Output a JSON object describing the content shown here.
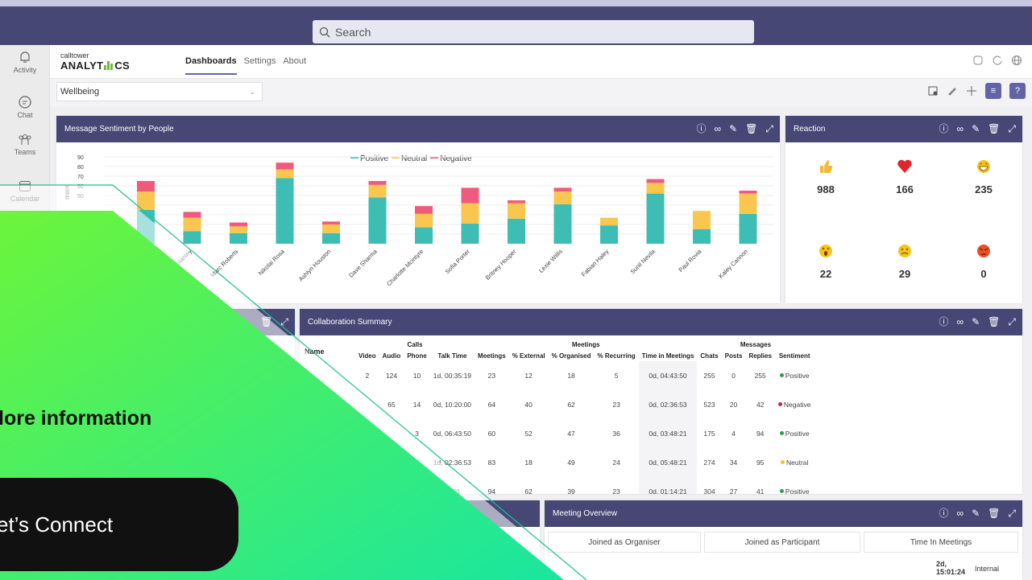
{
  "search": {
    "label": "Search"
  },
  "rail": [
    {
      "label": "Activity",
      "icon": "bell-icon"
    },
    {
      "label": "Chat",
      "icon": "chat-icon"
    },
    {
      "label": "Teams",
      "icon": "teams-icon"
    },
    {
      "label": "Calendar",
      "icon": "calendar-icon"
    }
  ],
  "app": {
    "logo_small": "calltower",
    "logo_big_a": "ANALYT",
    "logo_big_b": "CS",
    "tabs": [
      "Dashboards",
      "Settings",
      "About"
    ],
    "dropdown": "Wellbeing"
  },
  "sentiment": {
    "title": "Message Sentiment by People",
    "legend": [
      "Positive",
      "Neutral",
      "Negative"
    ],
    "ylabel_partial": "ment",
    "yticks": [
      "90",
      "80",
      "70",
      "60",
      "50"
    ]
  },
  "chart_data": {
    "type": "bar",
    "stacked": true,
    "categories": [
      "Jarrett Stanley",
      "Marc Roberts",
      "Nikolai Rosa",
      "Ashlyn Houston",
      "Dave Sharma",
      "Charlotte Mcintyre",
      "Sofia Porter",
      "Britney Hooper",
      "Lexie Willis",
      "Fabian Haley",
      "Sunil Nevila",
      "Paul Rovia",
      "Kaley Cannon"
    ],
    "hidden_first_categories": 2,
    "series": [
      {
        "name": "Positive",
        "color": "#3dbdb4",
        "values": [
          35,
          13,
          11,
          68,
          11,
          48,
          17,
          21,
          26,
          41,
          19,
          52,
          15,
          31
        ]
      },
      {
        "name": "Neutral",
        "color": "#f9c74f",
        "values": [
          19,
          14,
          7,
          9,
          9,
          13,
          14,
          21,
          16,
          13,
          8,
          11,
          19,
          21
        ]
      },
      {
        "name": "Negative",
        "color": "#f05a7e",
        "values": [
          11,
          6,
          4,
          7,
          3,
          4,
          8,
          16,
          3,
          4,
          0,
          4,
          0,
          3
        ]
      }
    ],
    "ylim": [
      0,
      90
    ]
  },
  "reaction": {
    "title": "Reaction",
    "items": [
      {
        "icon": "thumbs-up-icon",
        "value": "988",
        "color": "#f5b93a"
      },
      {
        "icon": "heart-icon",
        "value": "166",
        "color": "#e0262a"
      },
      {
        "icon": "laugh-icon",
        "value": "235",
        "color": "#f5c518"
      },
      {
        "icon": "surprised-icon",
        "value": "22",
        "color": "#f5c518"
      },
      {
        "icon": "sad-icon",
        "value": "29",
        "color": "#f5c518"
      },
      {
        "icon": "angry-icon",
        "value": "0",
        "color": "#e85024"
      }
    ]
  },
  "collab": {
    "title": "Collaboration Summary",
    "name_header": "Name",
    "groups": [
      "Calls",
      "Meetings",
      "Messages"
    ],
    "headers": [
      "Video",
      "Audio",
      "Phone",
      "Talk Time",
      "Meetings",
      "% External",
      "% Organised",
      "% Recurring",
      "Time in Meetings",
      "Chats",
      "Posts",
      "Replies",
      "Sentiment"
    ],
    "rows": [
      [
        "2",
        "124",
        "10",
        "1d, 00:35:19",
        "23",
        "12",
        "18",
        "5",
        "0d, 04:43:50",
        "255",
        "0",
        "255",
        "Positive"
      ],
      [
        "",
        "65",
        "14",
        "0d, 10:20:00",
        "64",
        "40",
        "62",
        "23",
        "0d, 02:36:53",
        "523",
        "20",
        "42",
        "Negative"
      ],
      [
        "",
        "",
        "3",
        "0d, 06:43:50",
        "60",
        "52",
        "47",
        "36",
        "0d, 03:48:21",
        "175",
        "4",
        "94",
        "Positive"
      ],
      [
        "",
        "",
        "",
        "1d, 02:36:53",
        "83",
        "18",
        "49",
        "24",
        "0d, 05:48:21",
        "274",
        "34",
        "95",
        "Neutral"
      ],
      [
        "",
        "",
        "",
        "48:21",
        "94",
        "62",
        "39",
        "23",
        "0d, 01:14:21",
        "304",
        "27",
        "41",
        "Positive"
      ]
    ],
    "sentiment_colors": {
      "Positive": "#2a9d4a",
      "Negative": "#d6213b",
      "Neutral": "#f5c518"
    }
  },
  "meeting": {
    "title": "Meeting Overview",
    "cols": [
      "Joined as Organiser",
      "Joined as Participant",
      "Time In Meetings"
    ],
    "partial_value": "2d, 15:01:24",
    "partial_label": "Internal"
  },
  "promo": {
    "text": "lore information",
    "button": "et’s Connect",
    "gradient_from": "#6cf53a",
    "gradient_to": "#19e6a0"
  }
}
